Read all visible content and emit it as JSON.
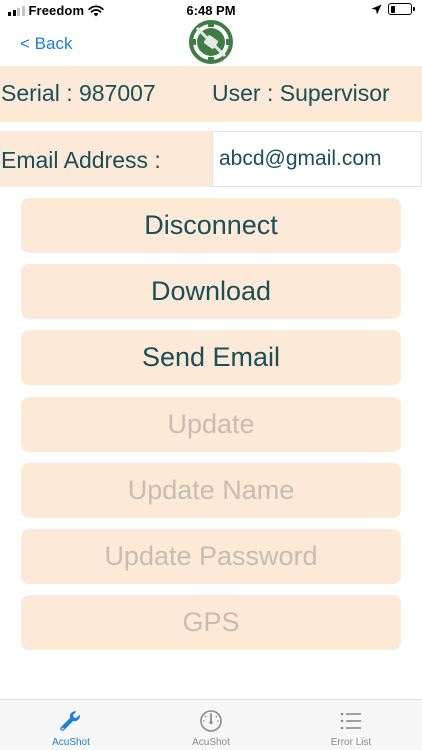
{
  "status_bar": {
    "carrier": "Freedom",
    "time": "6:48 PM",
    "icons": [
      "signal-bars-icon",
      "wifi-icon",
      "location-arrow-icon",
      "battery-icon"
    ]
  },
  "nav": {
    "back_label": "< Back",
    "logo_icon": "no-satellite-logo-icon"
  },
  "info": {
    "serial": "Serial : 987007",
    "user": "User : Supervisor"
  },
  "email": {
    "label": "Email Address :",
    "value": "abcd@gmail.com"
  },
  "actions": [
    {
      "label": "Disconnect",
      "enabled": true
    },
    {
      "label": "Download",
      "enabled": true
    },
    {
      "label": "Send Email",
      "enabled": true
    },
    {
      "label": "Update",
      "enabled": false
    },
    {
      "label": "Update Name",
      "enabled": false
    },
    {
      "label": "Update Password",
      "enabled": false
    },
    {
      "label": "GPS",
      "enabled": false
    }
  ],
  "tabs": [
    {
      "label": "AcuShot",
      "icon": "wrench-icon",
      "active": true
    },
    {
      "label": "AcuShot",
      "icon": "gauge-icon",
      "active": false
    },
    {
      "label": "Error List",
      "icon": "list-icon",
      "active": false
    }
  ],
  "colors": {
    "accent": "#1a7fd6",
    "panel": "#fce9d7",
    "text": "#1b4f55",
    "disabled_text": "#c8bcb1",
    "logo_green": "#3f7d45"
  }
}
